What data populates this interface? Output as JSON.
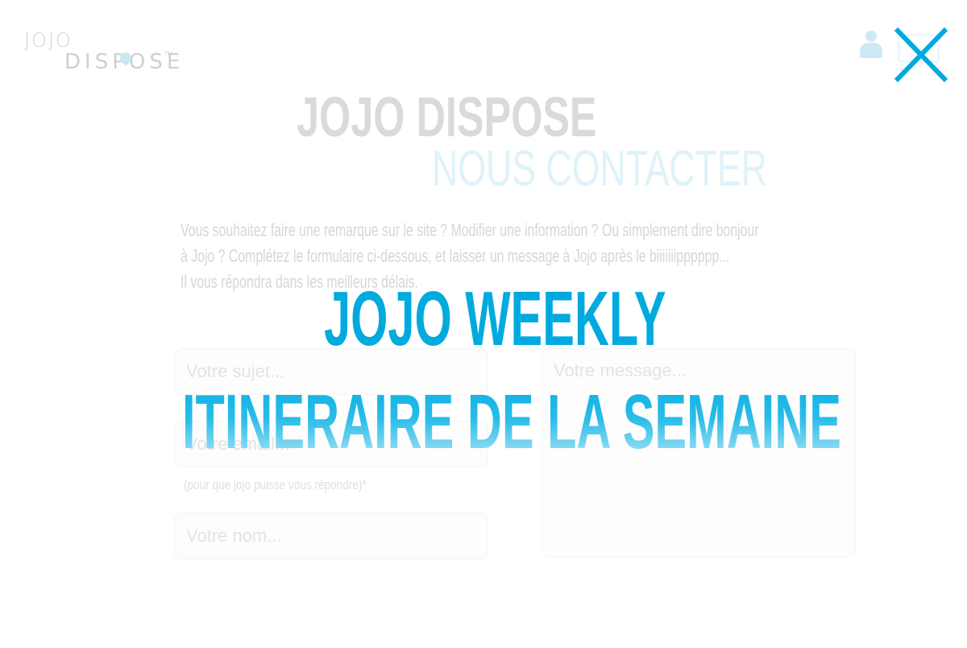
{
  "header": {
    "logo": {
      "line1": "JOJO",
      "line2": "DISPOSE",
      "trademark": "TM"
    },
    "user_icon": "user-icon",
    "close_icon": "close-icon",
    "close_label": "X"
  },
  "page": {
    "title": "JOJO DISPOSE",
    "section_title": "NOUS CONTACTER",
    "intro_lines": [
      "Vous souhaitez faire une remarque sur le site ? Modifier une information ? Ou simplement dire bonjour",
      "à Jojo ? Complétez le formulaire ci-dessous, et laisser un message à Jojo après le biiiiiiipppppp...",
      "Il vous répondra dans les meilleurs délais."
    ]
  },
  "form": {
    "subject_placeholder": "Votre sujet...",
    "email_placeholder": "Votre email...",
    "email_hint": "(pour que jojo puisse vous répondre)*",
    "name_placeholder": "Votre nom...",
    "message_placeholder": "Votre message..."
  },
  "overlay": {
    "title": "JOJO WEEKLY",
    "subtitle": "ITINERAIRE DE LA SEMAINE"
  },
  "colors": {
    "accent": "#00aade",
    "accent_light": "#dff2fa",
    "faded_text": "#d6d6d6"
  }
}
